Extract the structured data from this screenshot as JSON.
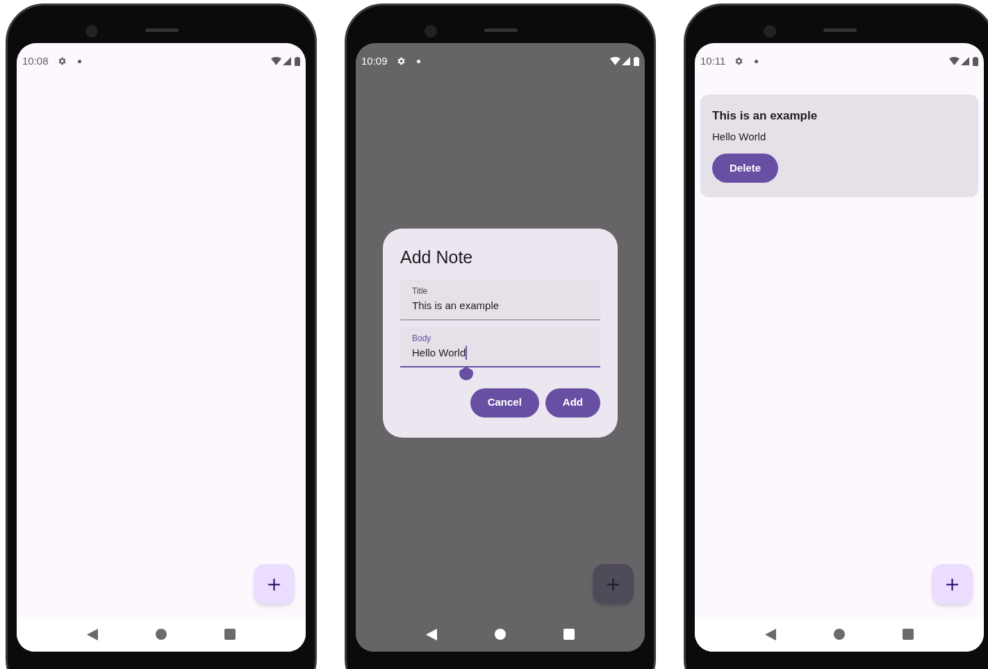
{
  "phones": [
    {
      "status_time": "10:08",
      "dimmed": false
    },
    {
      "status_time": "10:09",
      "dimmed": true,
      "dialog": {
        "title": "Add Note",
        "fields": [
          {
            "label": "Title",
            "value": "This is an example",
            "focused": false
          },
          {
            "label": "Body",
            "value": "Hello World",
            "focused": true
          }
        ],
        "buttons": [
          "Cancel",
          "Add"
        ]
      }
    },
    {
      "status_time": "10:11",
      "dimmed": false,
      "notes": [
        {
          "title": "This is an example",
          "body": "Hello World",
          "button": "Delete"
        }
      ]
    }
  ]
}
